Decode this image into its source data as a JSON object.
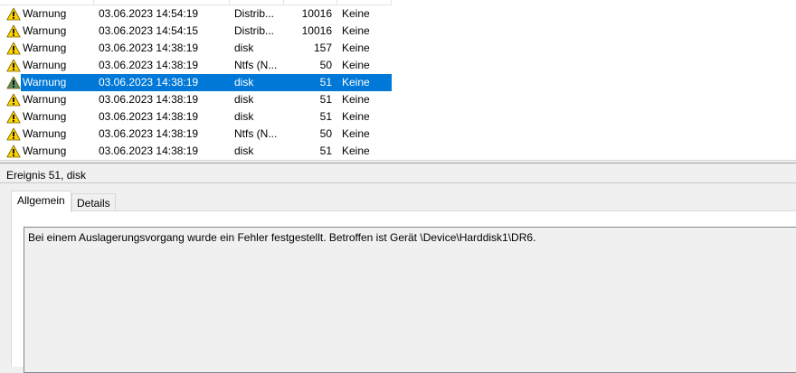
{
  "event_list": {
    "rows": [
      {
        "level": "Warnung",
        "date": "03.06.2023 14:54:19",
        "source": "Distrib...",
        "event_id": "10016",
        "task": "Keine",
        "selected": false
      },
      {
        "level": "Warnung",
        "date": "03.06.2023 14:54:15",
        "source": "Distrib...",
        "event_id": "10016",
        "task": "Keine",
        "selected": false
      },
      {
        "level": "Warnung",
        "date": "03.06.2023 14:38:19",
        "source": "disk",
        "event_id": "157",
        "task": "Keine",
        "selected": false
      },
      {
        "level": "Warnung",
        "date": "03.06.2023 14:38:19",
        "source": "Ntfs (N...",
        "event_id": "50",
        "task": "Keine",
        "selected": false
      },
      {
        "level": "Warnung",
        "date": "03.06.2023 14:38:19",
        "source": "disk",
        "event_id": "51",
        "task": "Keine",
        "selected": true
      },
      {
        "level": "Warnung",
        "date": "03.06.2023 14:38:19",
        "source": "disk",
        "event_id": "51",
        "task": "Keine",
        "selected": false
      },
      {
        "level": "Warnung",
        "date": "03.06.2023 14:38:19",
        "source": "disk",
        "event_id": "51",
        "task": "Keine",
        "selected": false
      },
      {
        "level": "Warnung",
        "date": "03.06.2023 14:38:19",
        "source": "Ntfs (N...",
        "event_id": "50",
        "task": "Keine",
        "selected": false
      },
      {
        "level": "Warnung",
        "date": "03.06.2023 14:38:19",
        "source": "disk",
        "event_id": "51",
        "task": "Keine",
        "selected": false
      }
    ],
    "icon": "warning-triangle-icon",
    "colors": {
      "selection": "#0078d7",
      "warning_fill": "#ffd400"
    }
  },
  "details": {
    "title": "Ereignis 51, disk",
    "tabs": {
      "general": "Allgemein",
      "details": "Details"
    },
    "message": "Bei einem Auslagerungsvorgang wurde ein Fehler festgestellt. Betroffen ist Gerät \\Device\\Harddisk1\\DR6."
  }
}
